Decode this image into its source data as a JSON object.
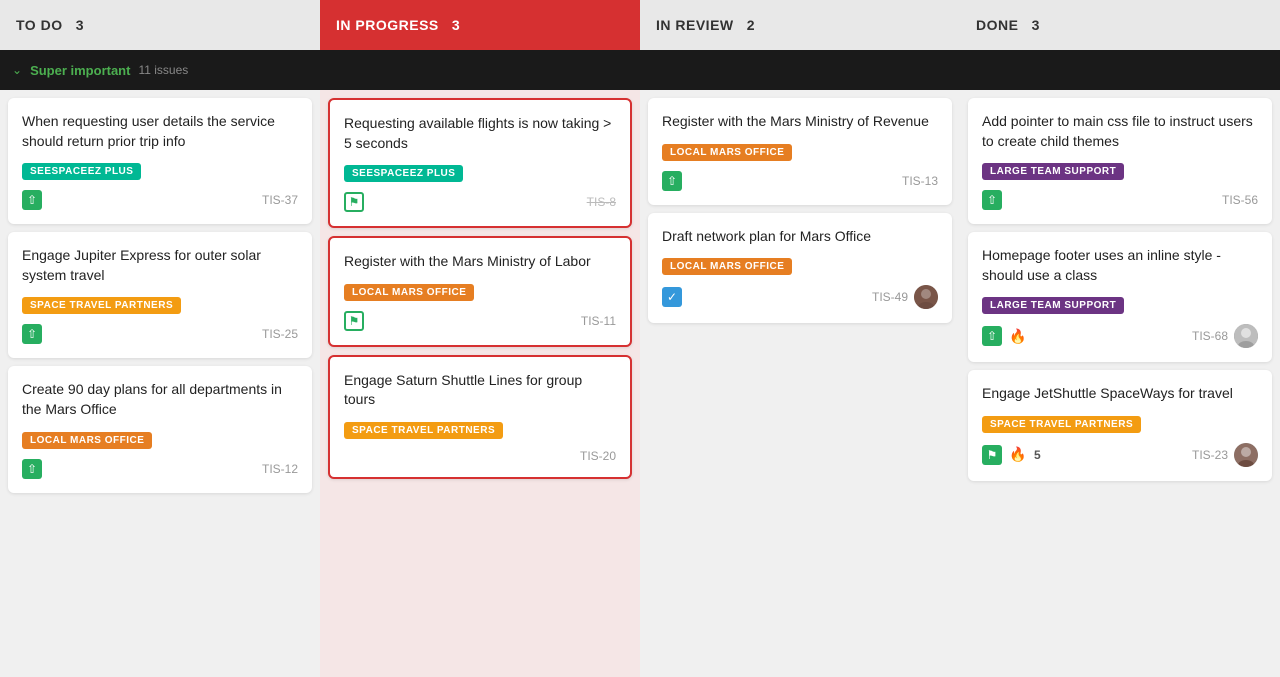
{
  "columns": [
    {
      "id": "todo",
      "label": "TO DO",
      "count": 3,
      "type": "todo",
      "cards": [
        {
          "title": "When requesting user details the service should return prior trip info",
          "tag": {
            "text": "SEESPACEEZ PLUS",
            "color": "teal"
          },
          "icons": [
            "up"
          ],
          "id": "TIS-37",
          "selected": false
        },
        {
          "title": "Engage Jupiter Express for outer solar system travel",
          "tag": {
            "text": "SPACE TRAVEL PARTNERS",
            "color": "yellow"
          },
          "icons": [
            "up"
          ],
          "id": "TIS-25",
          "selected": false
        },
        {
          "title": "Create 90 day plans for all departments in the Mars Office",
          "tag": {
            "text": "LOCAL MARS OFFICE",
            "color": "orange"
          },
          "icons": [
            "up"
          ],
          "id": "TIS-12",
          "selected": false
        }
      ]
    },
    {
      "id": "inprogress",
      "label": "IN PROGRESS",
      "count": 3,
      "type": "inprogress",
      "cards": [
        {
          "title": "Requesting available flights is now taking > 5 seconds",
          "tag": {
            "text": "SEESPACEEZ PLUS",
            "color": "teal"
          },
          "icons": [
            "bookmark-outline"
          ],
          "id": "TIS-8",
          "strikethrough": true,
          "selected": true
        },
        {
          "title": "Register with the Mars Ministry of Labor",
          "tag": {
            "text": "LOCAL MARS OFFICE",
            "color": "orange"
          },
          "icons": [
            "bookmark-outline"
          ],
          "id": "TIS-11",
          "selected": true
        },
        {
          "title": "Engage Saturn Shuttle Lines for group tours",
          "tag": {
            "text": "SPACE TRAVEL PARTNERS",
            "color": "yellow"
          },
          "icons": [],
          "id": "TIS-20",
          "selected": true
        }
      ]
    },
    {
      "id": "inreview",
      "label": "IN REVIEW",
      "count": 2,
      "type": "inreview",
      "cards": [
        {
          "title": "Register with the Mars Ministry of Revenue",
          "tag": {
            "text": "LOCAL MARS OFFICE",
            "color": "orange"
          },
          "icons": [
            "up"
          ],
          "id": "TIS-13",
          "selected": false
        },
        {
          "title": "Draft network plan for Mars Office",
          "tag": {
            "text": "LOCAL MARS OFFICE",
            "color": "orange"
          },
          "icons": [
            "check"
          ],
          "id": "TIS-49",
          "avatar": "astronaut1",
          "selected": false
        }
      ]
    },
    {
      "id": "done",
      "label": "DONE",
      "count": 3,
      "type": "done",
      "cards": [
        {
          "title": "Add pointer to main css file to instruct users to create child themes",
          "tag": {
            "text": "LARGE TEAM SUPPORT",
            "color": "purple"
          },
          "icons": [
            "up"
          ],
          "id": "TIS-56",
          "selected": false
        },
        {
          "title": "Homepage footer uses an inline style - should use a class",
          "tag": {
            "text": "LARGE TEAM SUPPORT",
            "color": "purple"
          },
          "icons": [
            "up",
            "fire"
          ],
          "id": "TIS-68",
          "avatar": "astronaut2",
          "selected": false
        },
        {
          "title": "Engage JetShuttle SpaceWays for travel",
          "tag": {
            "text": "SPACE TRAVEL PARTNERS",
            "color": "yellow"
          },
          "icons": [
            "bookmark",
            "fire"
          ],
          "id": "TIS-23",
          "badge": "5",
          "avatar": "astronaut3",
          "selected": false
        }
      ]
    }
  ],
  "group": {
    "label": "Super important",
    "count": "11 issues"
  }
}
